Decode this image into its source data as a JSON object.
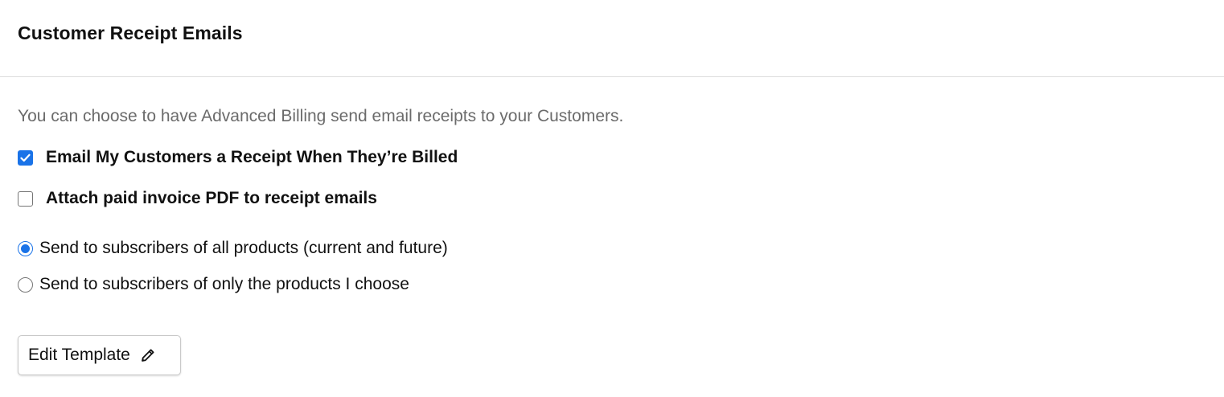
{
  "header": {
    "title": "Customer Receipt Emails"
  },
  "main": {
    "description": "You can choose to have Advanced Billing send email receipts to your Customers.",
    "checkboxes": [
      {
        "label": "Email My Customers a Receipt When They’re Billed",
        "checked": true
      },
      {
        "label": "Attach paid invoice PDF to receipt emails",
        "checked": false
      }
    ],
    "radios": [
      {
        "label": "Send to subscribers of all products (current and future)",
        "selected": true
      },
      {
        "label": "Send to subscribers of only the products I choose",
        "selected": false
      }
    ],
    "edit_button": {
      "label": "Edit Template",
      "icon": "pencil-icon"
    }
  },
  "colors": {
    "accent": "#1a73e8",
    "muted_text": "#6b6b6b",
    "divider": "#dcdcdc"
  }
}
